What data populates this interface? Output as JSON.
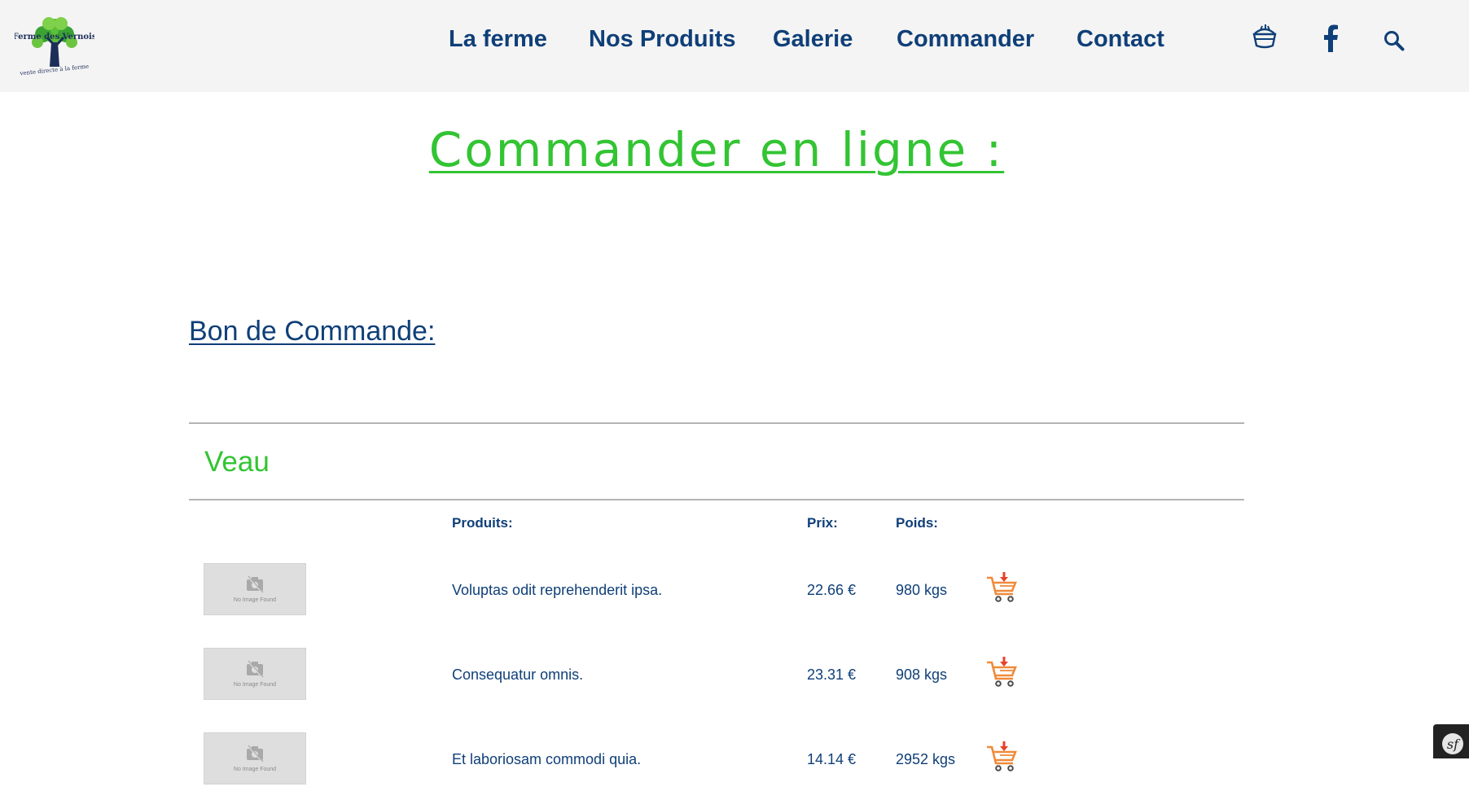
{
  "header": {
    "logo": {
      "brand_name": "Ferme des Vernois",
      "tagline": "vente directe à la ferme"
    },
    "nav": [
      {
        "label": "La ferme"
      },
      {
        "label": "Nos Produits"
      },
      {
        "label": "Galerie"
      },
      {
        "label": "Commander"
      },
      {
        "label": "Contact"
      }
    ],
    "icons": [
      "basket-icon",
      "facebook-icon",
      "search-icon"
    ]
  },
  "page": {
    "title": "Commander en ligne :",
    "subtitle": "Bon de Commande:"
  },
  "order_table": {
    "category": "Veau",
    "columns": {
      "products": "Produits:",
      "price": "Prix:",
      "weight": "Poids:"
    },
    "placeholder_text": "No Image Found",
    "rows": [
      {
        "name": "Voluptas odit reprehenderit ipsa.",
        "price": "22.66 €",
        "weight": "980 kgs"
      },
      {
        "name": "Consequatur omnis.",
        "price": "23.31 €",
        "weight": "908 kgs"
      },
      {
        "name": "Et laboriosam commodi quia.",
        "price": "14.14 €",
        "weight": "2952 kgs"
      }
    ]
  },
  "colors": {
    "navy": "#0f3f78",
    "green": "#33c433",
    "cart_orange": "#f08a3a",
    "cart_red": "#e8412b",
    "header_bg": "#f4f4f4"
  }
}
